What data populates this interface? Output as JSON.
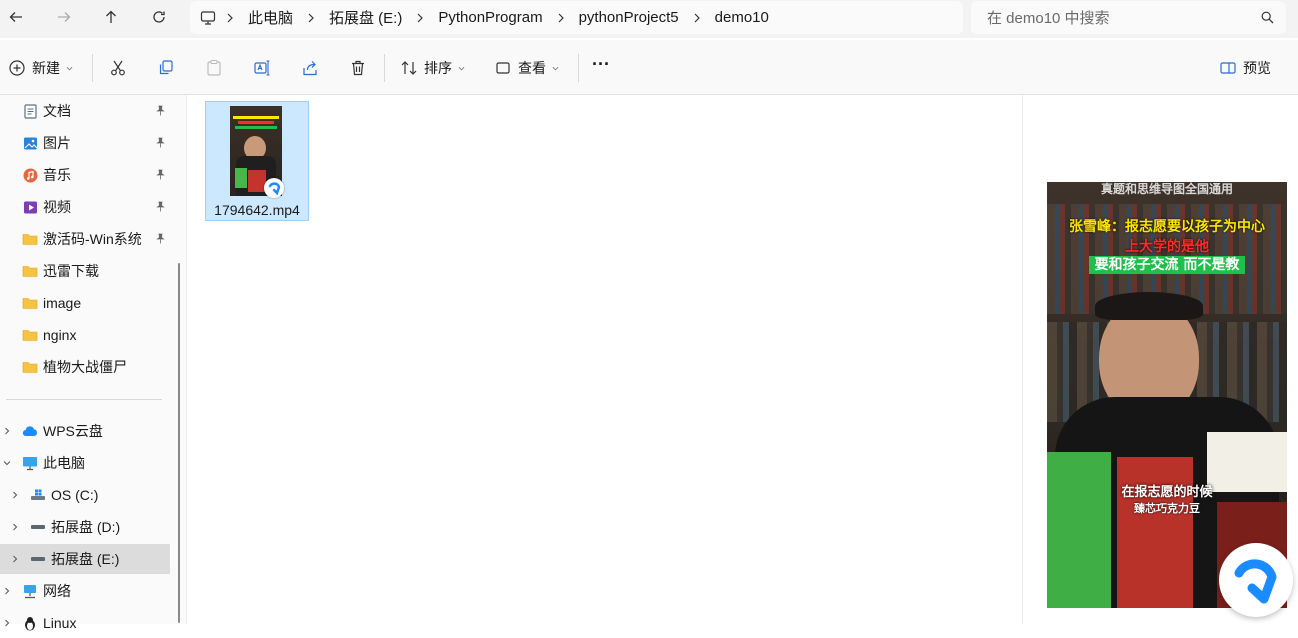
{
  "address": {
    "crumbs": [
      "此电脑",
      "拓展盘 (E:)",
      "PythonProgram",
      "pythonProject5",
      "demo10"
    ]
  },
  "search": {
    "placeholder": "在 demo10 中搜索"
  },
  "toolbar": {
    "new_label": "新建",
    "sort_label": "排序",
    "view_label": "查看",
    "more_label": "···",
    "preview_label": "预览"
  },
  "sidebar": {
    "quick_access": [
      {
        "label": "文档",
        "icon": "document-icon",
        "pinned": true
      },
      {
        "label": "图片",
        "icon": "pictures-icon",
        "pinned": true
      },
      {
        "label": "音乐",
        "icon": "music-icon",
        "pinned": true
      },
      {
        "label": "视频",
        "icon": "videos-icon",
        "pinned": true
      },
      {
        "label": "激活码-Win系统",
        "icon": "folder-icon",
        "pinned": true
      },
      {
        "label": "迅雷下载",
        "icon": "folder-icon",
        "pinned": false
      },
      {
        "label": "image",
        "icon": "folder-icon",
        "pinned": false
      },
      {
        "label": "nginx",
        "icon": "folder-icon",
        "pinned": false
      },
      {
        "label": "植物大战僵尸",
        "icon": "folder-icon",
        "pinned": false
      }
    ],
    "tree": [
      {
        "label": "WPS云盘",
        "icon": "cloud-icon"
      },
      {
        "label": "此电脑",
        "icon": "pc-icon"
      },
      {
        "label": "OS (C:)",
        "icon": "windows-drive-icon"
      },
      {
        "label": "拓展盘 (D:)",
        "icon": "drive-icon"
      },
      {
        "label": "拓展盘 (E:)",
        "icon": "drive-icon"
      },
      {
        "label": "网络",
        "icon": "network-icon"
      },
      {
        "label": "Linux",
        "icon": "linux-icon"
      }
    ]
  },
  "files": [
    {
      "name": "1794642.mp4",
      "type": "video",
      "selected": true
    }
  ],
  "preview": {
    "lines": [
      "真题和思维导图全国通用",
      "张雪峰：报志愿要以孩子为中心",
      "上大学的是他",
      "要和孩子交流 而不是教",
      "在报志愿的时候",
      "臻芯巧克力豆"
    ],
    "colors": {
      "headline": "#ffe600",
      "subline": "#ff2a2a",
      "green_band": "#1fbf4a"
    }
  },
  "colors": {
    "selection_fill": "#cce8ff",
    "selection_border": "#99d1ff",
    "folder": "#f6c344",
    "accent": "#0a64c8"
  }
}
